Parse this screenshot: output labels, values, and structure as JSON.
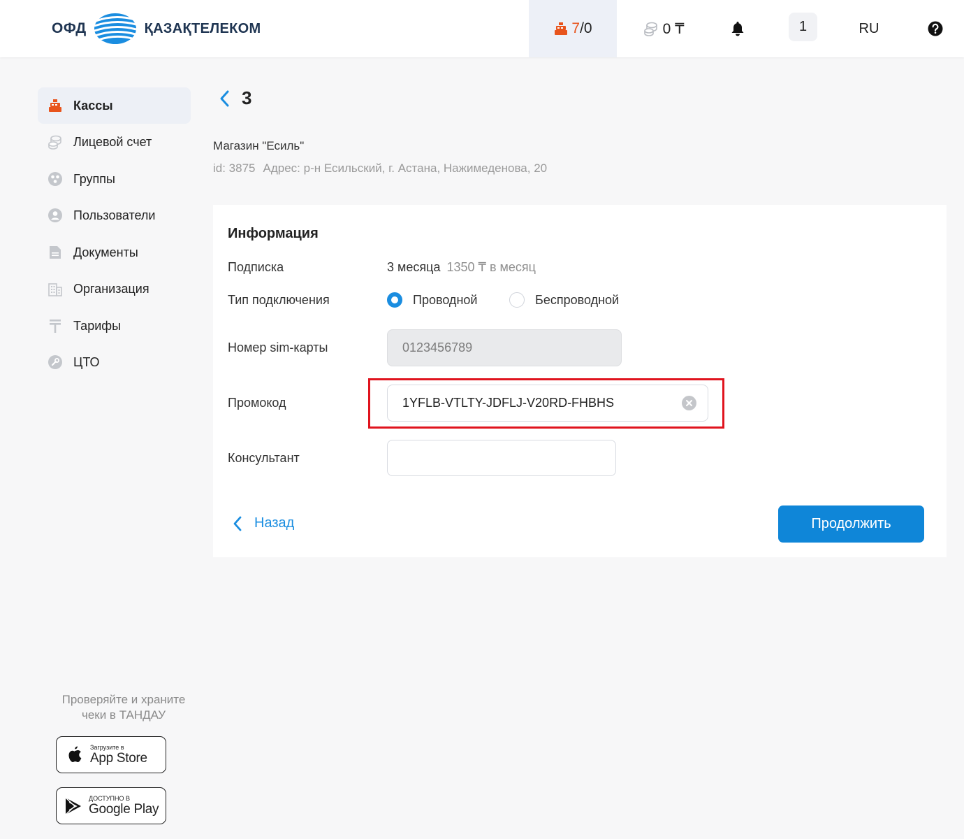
{
  "header": {
    "logo_left": "ОФД",
    "logo_right": "ҚАЗАҚТЕЛЕКОМ",
    "kassa_active": "7",
    "kassa_rest": "/0",
    "balance": "0 ₸",
    "notifications_count": "1",
    "language": "RU"
  },
  "sidebar": {
    "items": [
      {
        "label": "Кассы",
        "icon": "cash-register-icon",
        "active": true
      },
      {
        "label": "Лицевой счет",
        "icon": "coins-icon",
        "active": false
      },
      {
        "label": "Группы",
        "icon": "groups-icon",
        "active": false
      },
      {
        "label": "Пользователи",
        "icon": "user-icon",
        "active": false
      },
      {
        "label": "Документы",
        "icon": "document-icon",
        "active": false
      },
      {
        "label": "Организация",
        "icon": "building-icon",
        "active": false
      },
      {
        "label": "Тарифы",
        "icon": "tenge-icon",
        "active": false
      },
      {
        "label": "ЦТО",
        "icon": "wrench-icon",
        "active": false
      }
    ],
    "promo_line1": "Проверяйте и храните",
    "promo_line2": "чеки в ТАНДАУ",
    "appstore_small": "Загрузите в",
    "appstore_big": "App Store",
    "googleplay_small": "ДОСТУПНО В",
    "googleplay_big": "Google Play"
  },
  "main": {
    "title": "3",
    "shop_name": "Магазин \"Есиль\"",
    "shop_id": "id: 3875",
    "shop_address": "Адрес: р-н Есильский, г. Астана, Нажимеденова, 20",
    "card": {
      "title": "Информация",
      "subscription_label": "Подписка",
      "subscription_value": "3 месяца",
      "subscription_price": "1350 ₸ в месяц",
      "connection_label": "Тип подключения",
      "connection_options": [
        "Проводной",
        "Беспроводной"
      ],
      "connection_selected": "Проводной",
      "sim_label": "Номер sim-карты",
      "sim_value": "0123456789",
      "promo_label": "Промокод",
      "promo_value": "1YFLB-VTLTY-JDFLJ-V20RD-FHBHS",
      "consultant_label": "Консультант",
      "consultant_value": "",
      "back_label": "Назад",
      "continue_label": "Продолжить"
    }
  },
  "colors": {
    "accent": "#0f86d8",
    "brand_orange": "#e8541c",
    "highlight": "#e0141e"
  }
}
